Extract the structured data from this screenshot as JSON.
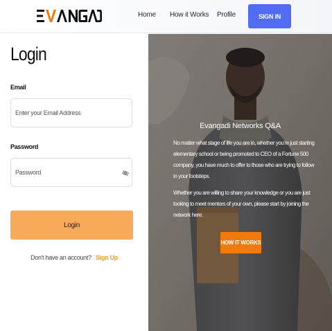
{
  "header": {
    "logo_alt": "EVANGADI",
    "nav": [
      {
        "label": "Home"
      },
      {
        "label": "How it Works"
      },
      {
        "label": "Profile"
      }
    ],
    "signin_label": "SIGN IN",
    "accent_color": "#516cf0"
  },
  "login": {
    "title": "Login",
    "email_label": "Email",
    "email_placeholder": "Enter your Email Address",
    "password_label": "Password",
    "password_placeholder": "Password",
    "eye_icon": "eye-off-icon",
    "login_button": "Login",
    "signup_prompt": "Don't have an account?",
    "signup_link": "Sign Up",
    "button_color": "#f9a95a",
    "link_color": "#f29b1d"
  },
  "hero": {
    "title": "Evangadi Networks Q&A",
    "paragraph_1": "No matter what stage of life you are in, whether you're just starting elementary school or being promoted to CEO of a Fortune 500 company, you have much to offer to those who are trying to follow in your footsteps.",
    "paragraph_2": "Whether you are willing to share your knowledge or you are just looking to meet mentors of your own, please start by joining the network here.",
    "button_label": "HOW IT WORKS",
    "button_color": "#f07b0c"
  }
}
